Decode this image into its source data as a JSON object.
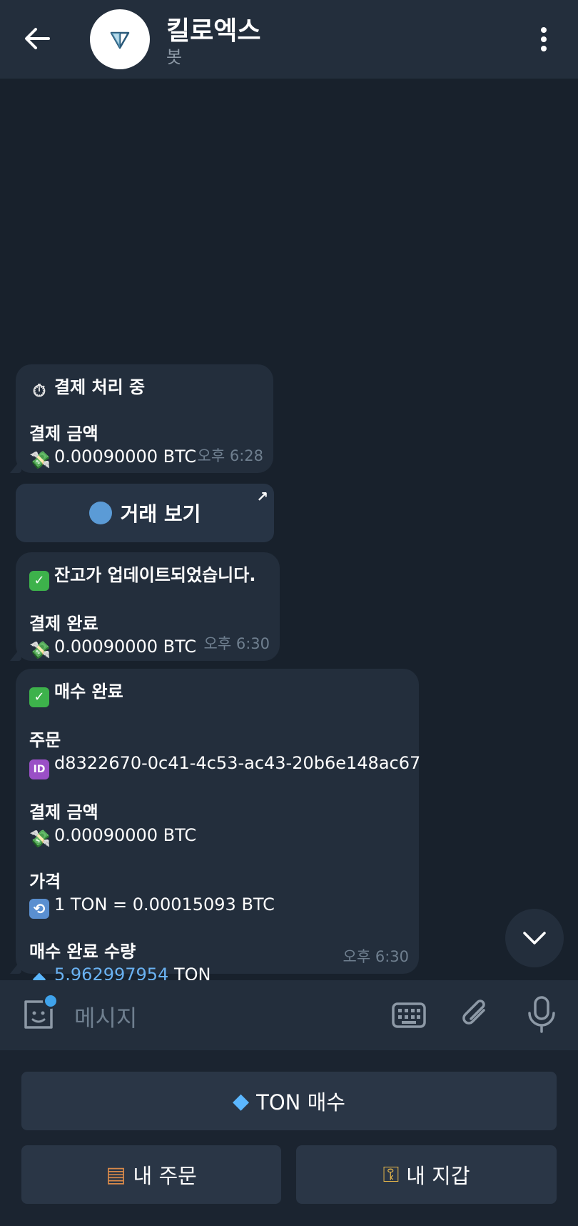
{
  "header": {
    "title": "킬로엑스",
    "subtitle": "봇"
  },
  "messages": {
    "m1": {
      "line1": "결제 처리 중",
      "label1": "결제 금액",
      "amount": "0.00090000 BTC",
      "time": "오후 6:28"
    },
    "inline_button": {
      "label": "거래 보기"
    },
    "m2": {
      "line1": "잔고가 업데이트되었습니다.",
      "label1": "결제 완료",
      "amount": "0.00090000 BTC",
      "time": "오후 6:30"
    },
    "m3": {
      "line1": "매수 완료",
      "order_label": "주문",
      "order_id": "d8322670-0c41-4c53-ac43-20b6e148ac67",
      "pay_label": "결제 금액",
      "pay_amount": "0.00090000 BTC",
      "price_label": "가격",
      "price_value": "1 TON = 0.00015093 BTC",
      "qty_label": "매수 완료 수량",
      "qty_value": "5.962997954",
      "qty_unit": "TON",
      "time": "오후 6:30"
    }
  },
  "input": {
    "placeholder": "메시지"
  },
  "bot_keyboard": {
    "buy": "TON 매수",
    "orders": "내 주문",
    "wallet": "내 지갑"
  },
  "colors": {
    "background": "#18212c",
    "bubble": "#232e3c",
    "link": "#6ab2f2",
    "accent": "#3fa3ec"
  },
  "icons": [
    "back-arrow-icon",
    "bot-avatar-icon",
    "more-vert-icon",
    "timer-icon",
    "money-icon",
    "globe-icon",
    "external-link-icon",
    "check-icon",
    "id-icon",
    "sync-icon",
    "diamond-icon",
    "chevron-down-icon",
    "sticker-icon",
    "keyboard-icon",
    "paperclip-icon",
    "mic-icon",
    "books-icon",
    "key-icon"
  ]
}
